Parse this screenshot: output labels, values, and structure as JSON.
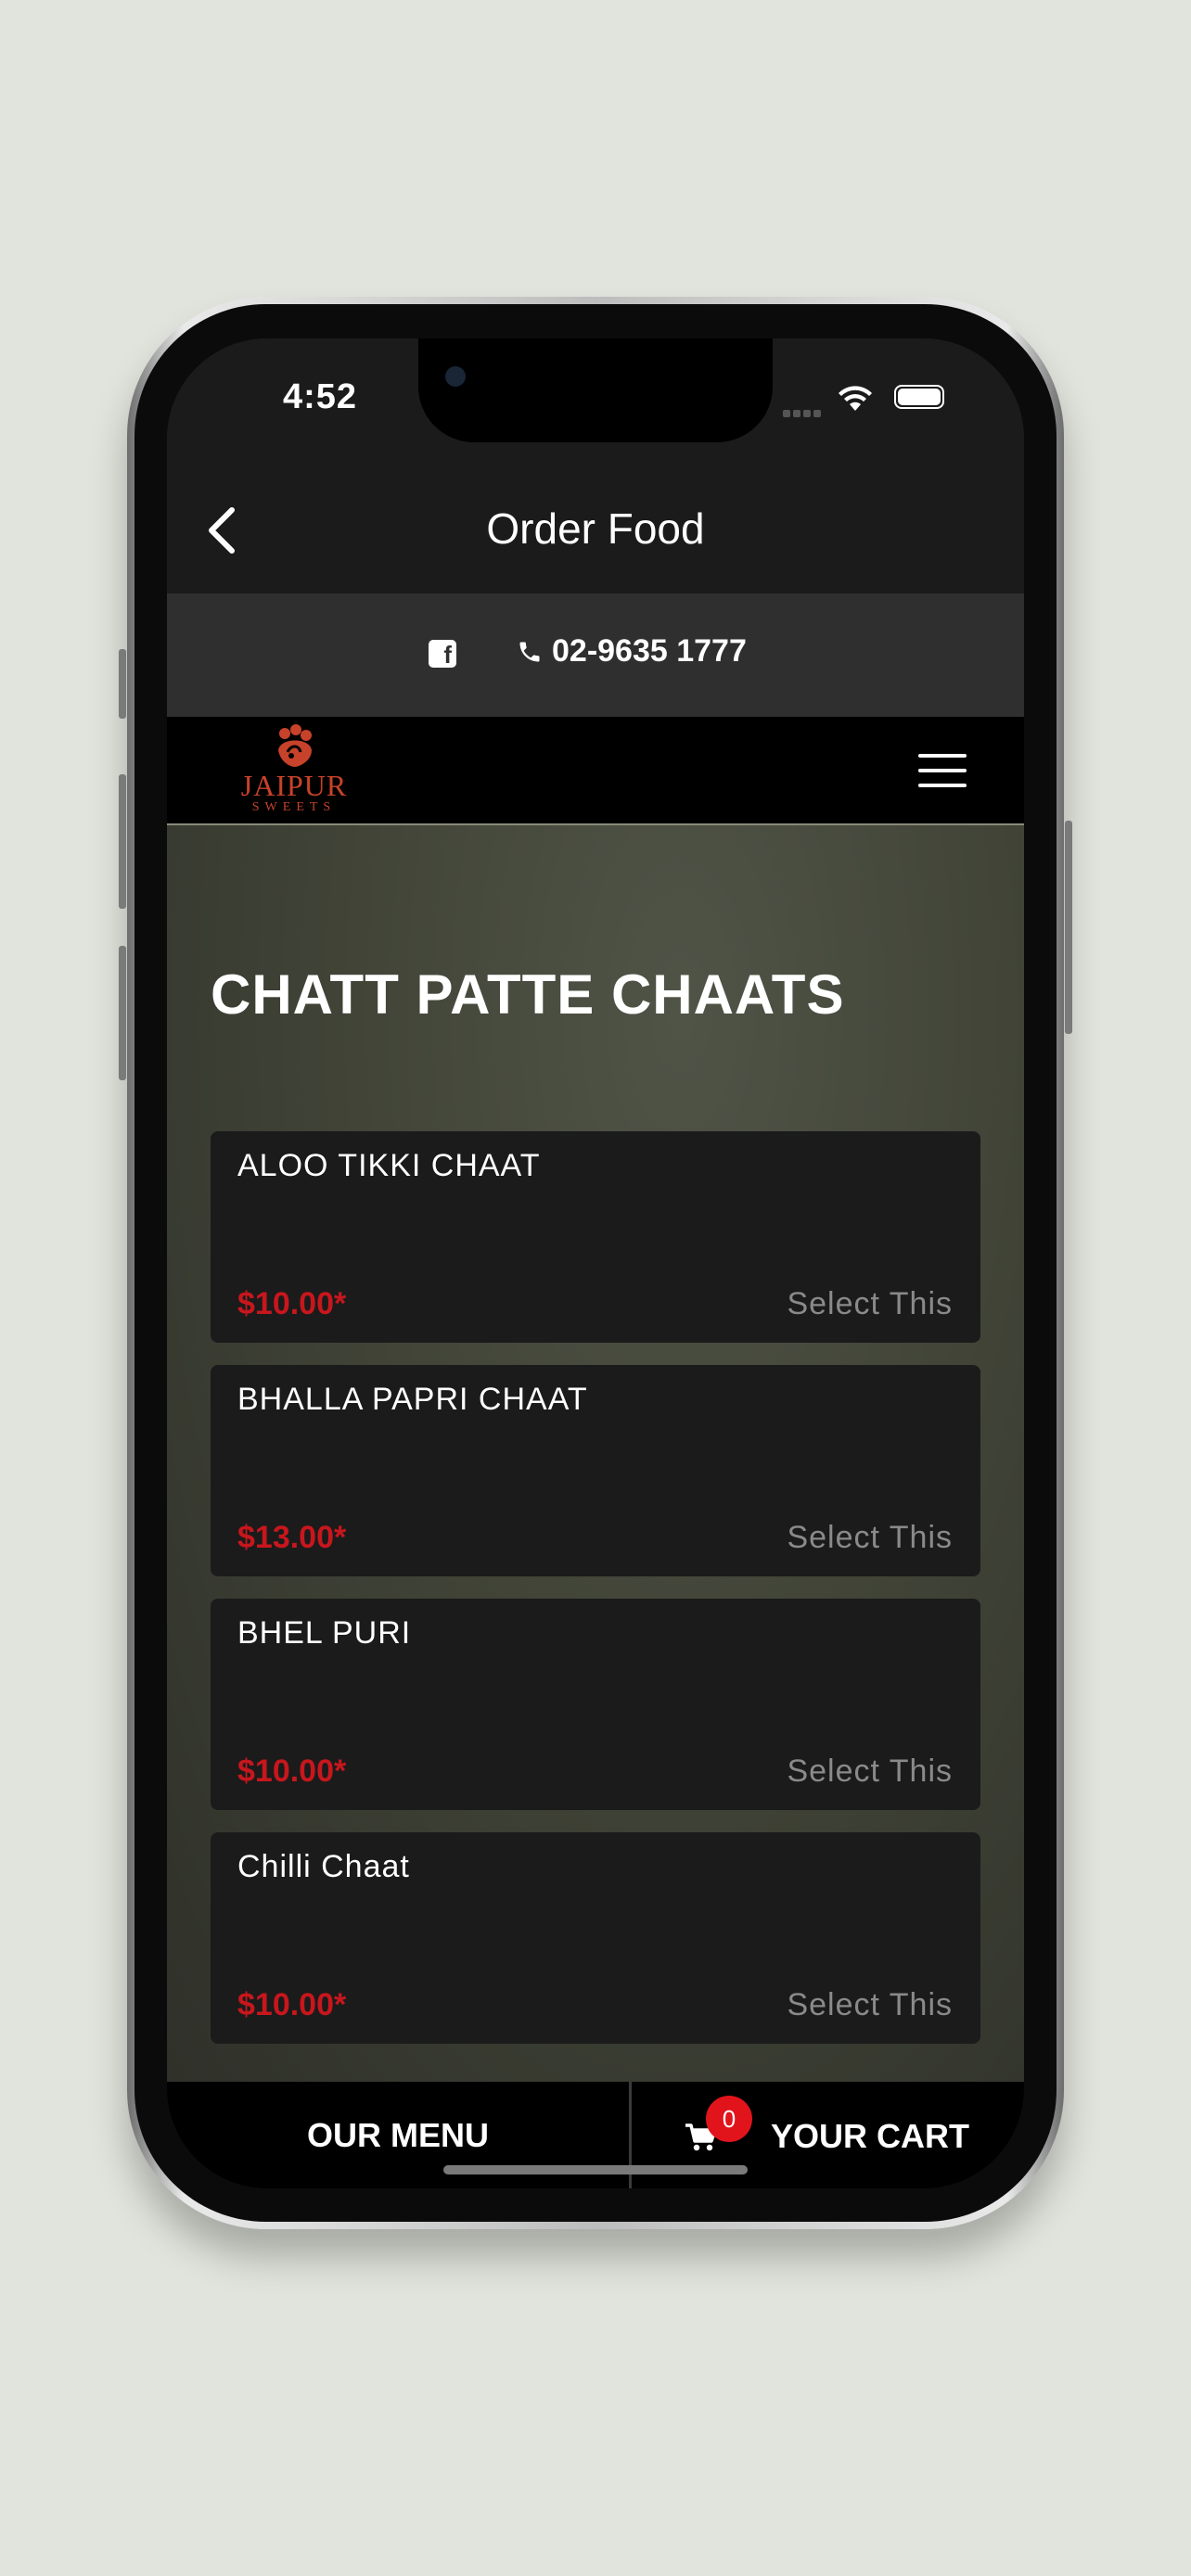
{
  "status_bar": {
    "time": "4:52"
  },
  "header": {
    "title": "Order Food",
    "back_icon": "chevron-left-icon"
  },
  "contact": {
    "facebook_icon": "facebook-icon",
    "phone_icon": "phone-icon",
    "phone": "02-9635 1777"
  },
  "brand": {
    "logo_main": "JAIPUR",
    "logo_sub": "SWEETS",
    "menu_icon": "hamburger-icon",
    "logo_color": "#c7422a"
  },
  "category": {
    "title": "CHATT PATTE CHAATS"
  },
  "items": [
    {
      "name": "ALOO TIKKI CHAAT",
      "price": "$10.00*",
      "action": "Select This"
    },
    {
      "name": "BHALLA PAPRI CHAAT",
      "price": "$13.00*",
      "action": "Select This"
    },
    {
      "name": "BHEL PURI",
      "price": "$10.00*",
      "action": "Select This"
    },
    {
      "name": "Chilli Chaat",
      "price": "$10.00*",
      "action": "Select This"
    }
  ],
  "bottom_bar": {
    "menu_label": "OUR MENU",
    "cart_label": "YOUR CART",
    "cart_count": "0",
    "cart_icon": "cart-icon"
  },
  "colors": {
    "price": "#c8161d",
    "badge": "#e1141c",
    "header_bg": "#1b1b1b",
    "contact_bg": "#2f2f2f"
  }
}
